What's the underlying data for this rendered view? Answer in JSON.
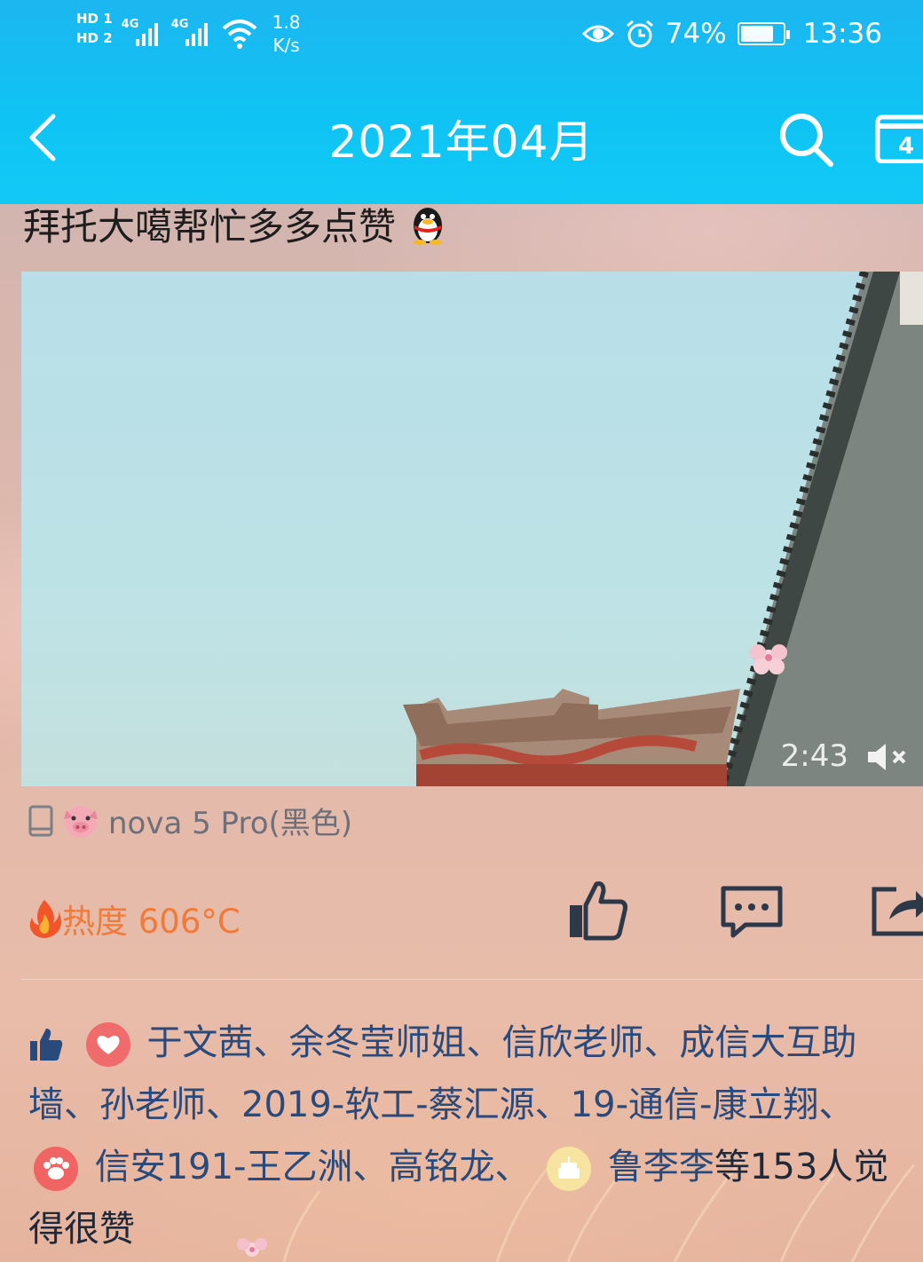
{
  "status_bar": {
    "sim1": "HD 1",
    "sim2": "HD 2",
    "net1": "4G",
    "net2": "4G",
    "speed_value": "1.8",
    "speed_unit": "K/s",
    "battery": "74%",
    "time": "13:36"
  },
  "header": {
    "title": "2021年04月",
    "calendar_day": "4"
  },
  "post": {
    "text": "拜托大噶帮忙多多点赞"
  },
  "video": {
    "duration": "2:43"
  },
  "device": {
    "name": "nova 5 Pro(黑色)"
  },
  "stats": {
    "heat_label": "热度 606°C"
  },
  "likes": {
    "names": [
      "于文茜",
      "余冬莹师姐",
      "信欣老师",
      "成信大互助墙",
      "孙老师",
      "2019-软工-蔡汇源",
      "19-通信-康立翔"
    ],
    "names2": [
      "信安191-王乙洲",
      "高铭龙"
    ],
    "last_name": "鲁李李",
    "suffix": "等153人觉得很赞"
  },
  "colors": {
    "header_blue": "#12c0f3",
    "heat_orange": "#f07a3a",
    "link_blue": "#2a4a7c"
  }
}
